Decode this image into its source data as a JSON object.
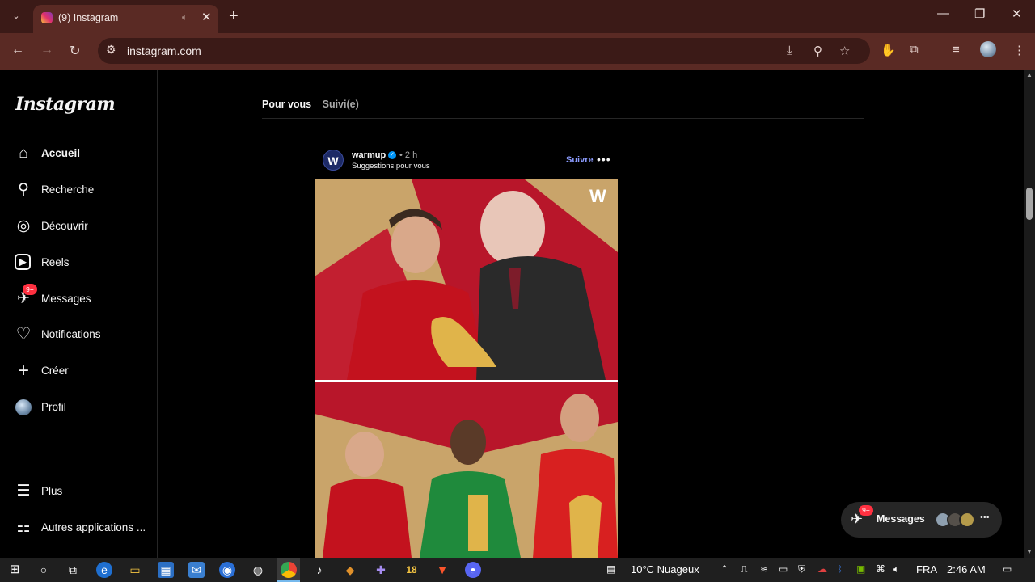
{
  "browser": {
    "tab_title": "(9) Instagram",
    "url": "instagram.com",
    "new_tab": "+",
    "tab_close": "✕",
    "dropdown": "⌄"
  },
  "sidebar": {
    "logo": "Instagram",
    "items": [
      {
        "label": "Accueil",
        "icon": "home-icon",
        "glyph": "⌂"
      },
      {
        "label": "Recherche",
        "icon": "search-icon",
        "glyph": "⚲"
      },
      {
        "label": "Découvrir",
        "icon": "compass-icon",
        "glyph": "◎"
      },
      {
        "label": "Reels",
        "icon": "reels-icon",
        "glyph": "▶"
      },
      {
        "label": "Messages",
        "icon": "messenger-icon",
        "glyph": "✈",
        "badge": "9+"
      },
      {
        "label": "Notifications",
        "icon": "heart-icon",
        "glyph": "♡"
      },
      {
        "label": "Créer",
        "icon": "plus-icon",
        "glyph": "+"
      },
      {
        "label": "Profil",
        "icon": "avatar"
      },
      {
        "label": "Plus",
        "icon": "menu-icon",
        "glyph": "☰"
      },
      {
        "label": "Autres applications ...",
        "icon": "apps-icon",
        "glyph": "⚏"
      }
    ]
  },
  "feed": {
    "tab_for_you": "Pour vous",
    "tab_following": "Suivi(e)"
  },
  "post": {
    "username": "warmup",
    "time": "• 2 h",
    "subtitle": "Suggestions pour vous",
    "follow": "Suivre",
    "more": "•••",
    "avatar_letter": "W"
  },
  "messages_pill": {
    "label": "Messages",
    "badge": "9+",
    "more": "•••"
  },
  "taskbar": {
    "weather": "10°C  Nuageux",
    "lang": "FRA",
    "time": "2:46 AM",
    "app_number": "18"
  },
  "colors": {
    "accent_link": "#8c9cff",
    "badge": "#ff3040",
    "chrome": "#5a2a24"
  }
}
